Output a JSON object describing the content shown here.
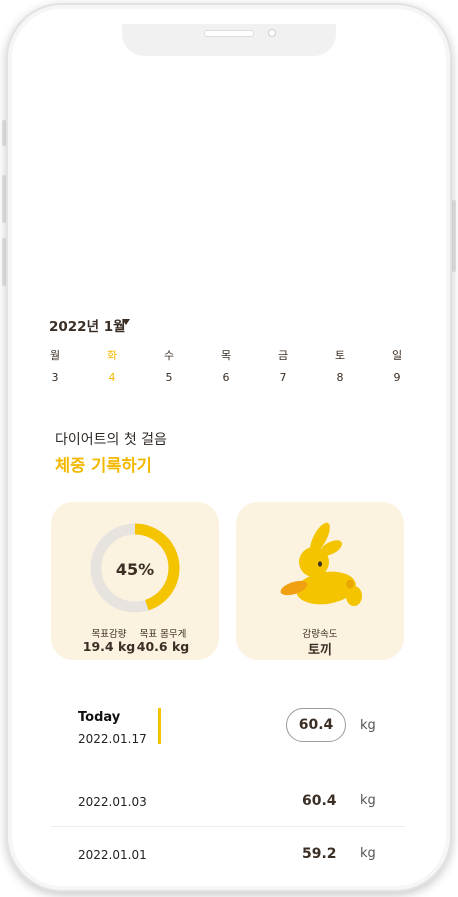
{
  "calendar": {
    "month_title": "2022년 1월",
    "days": [
      {
        "weekday": "월",
        "date": "3",
        "selected": false
      },
      {
        "weekday": "화",
        "date": "4",
        "selected": true
      },
      {
        "weekday": "수",
        "date": "5",
        "selected": false
      },
      {
        "weekday": "목",
        "date": "6",
        "selected": false
      },
      {
        "weekday": "금",
        "date": "7",
        "selected": false
      },
      {
        "weekday": "토",
        "date": "8",
        "selected": false
      },
      {
        "weekday": "일",
        "date": "9",
        "selected": false
      }
    ]
  },
  "intro": {
    "line1": "다이어트의 첫 걸음",
    "line2": "체중 기록하기"
  },
  "progress_card": {
    "percent_label": "45%",
    "progress": 0.45,
    "goal_loss_label": "목표감량",
    "goal_loss_value": "19.4 kg",
    "goal_weight_label": "목표 몸무게",
    "goal_weight_value": "40.6 kg"
  },
  "speed_card": {
    "label": "감량속도",
    "value": "토끼",
    "icon": "rabbit-icon"
  },
  "records": {
    "today": {
      "label": "Today",
      "date": "2022.01.17",
      "weight": "60.4",
      "unit": "kg"
    },
    "history": [
      {
        "date": "2022.01.03",
        "weight": "60.4",
        "unit": "kg"
      },
      {
        "date": "2022.01.01",
        "weight": "59.2",
        "unit": "kg"
      }
    ]
  },
  "colors": {
    "accent": "#f5b800",
    "card_bg": "#fbf3e0",
    "ring_track": "#e7e4df",
    "text_dark": "#3b2e24"
  }
}
